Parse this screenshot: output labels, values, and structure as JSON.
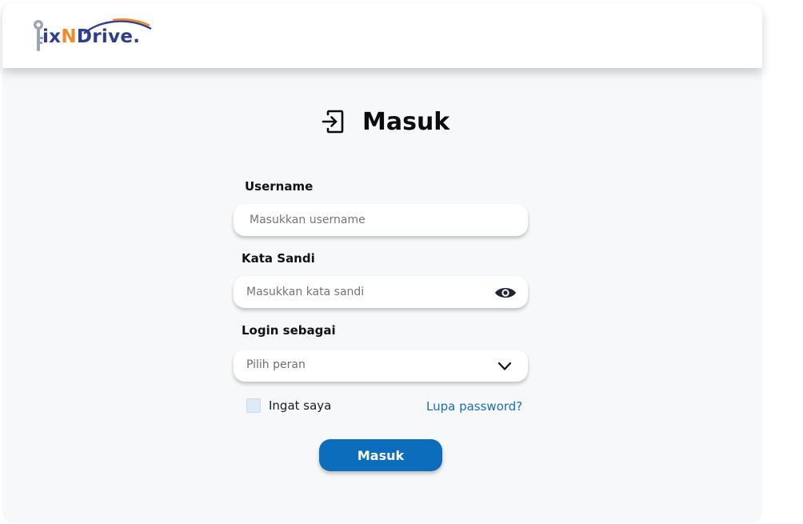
{
  "brand": {
    "logo_prefix": "ix",
    "logo_accent": "N",
    "logo_suffix": "Drive.",
    "logo_icon": "wrench-key-icon",
    "primary_color": "#2f3d8f",
    "accent_color": "#f08a2b"
  },
  "page": {
    "title": "Masuk",
    "title_icon": "login-icon"
  },
  "form": {
    "username_label": "Username",
    "username_placeholder": "Masukkan username",
    "password_label": "Kata Sandi",
    "password_placeholder": "Masukkan kata sandi",
    "password_toggle_icon": "eye-icon",
    "role_label": "Login sebagai",
    "role_placeholder": "Pilih peran",
    "role_icon": "chevron-down-icon",
    "remember_label": "Ingat saya",
    "forgot_label": "Lupa password?",
    "submit_label": "Masuk",
    "submit_color": "#0b6dbb",
    "link_color": "#1a6fb8"
  }
}
